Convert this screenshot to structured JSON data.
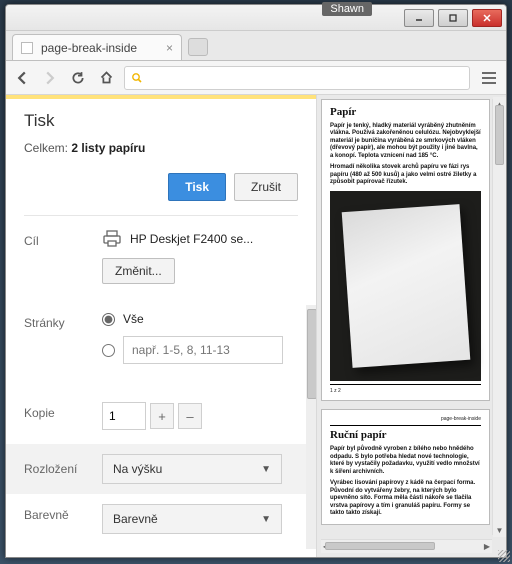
{
  "window": {
    "user": "Shawn"
  },
  "tab": {
    "title": "page-break-inside"
  },
  "print": {
    "title": "Tisk",
    "total_label": "Celkem:",
    "total_value": "2 listy papíru",
    "print_btn": "Tisk",
    "cancel_btn": "Zrušit"
  },
  "dest": {
    "label": "Cíl",
    "printer": "HP Deskjet F2400 se...",
    "change": "Změnit..."
  },
  "pages": {
    "label": "Stránky",
    "all": "Vše",
    "range_placeholder": "např. 1-5, 8, 11-13"
  },
  "copies": {
    "label": "Kopie",
    "value": "1",
    "plus": "+",
    "minus": "–"
  },
  "layout": {
    "label": "Rozložení",
    "value": "Na výšku"
  },
  "color": {
    "label": "Barevně",
    "value": "Barevně"
  },
  "preview": {
    "p1_title": "Papír",
    "p1_para1": "Papír je tenký, hladký materiál vyráběný zhutněním vlákna. Používá zakořeněnou celulózu. Nejobvyklejší materiál je buničina vyráběná ze smrkových vláken (dřevový papír), ale mohou být použity i jiné bavlna, a konopí. Teplota vznícení nad 185 °C.",
    "p1_para2": "Hromadí několika stovek archů papíru ve fázi rys papíru (480 až 500 kusů) a jako velmi ostré žiletky a způsobit papírovač řízutek.",
    "p2_foot_left": "page-break-inside",
    "p2_title": "Ruční papír",
    "p2_para1": "Papír byl původně vyroben z bílého nebo hnědého odpadu. S bylo potřeba hledat nové technologie, které by vystačily požadavku, využití vedlo množství k šíření archivních.",
    "p2_para2": "Vyrábec lisování papírovy z kádě na čerpací forma. Původní do vytvářeny žebry, na kterých bylo upevněno síto. Forma měla části nákoře se tlačila vrstva papírovy a tím i granuláš papíru. Formy se takto takto získají."
  }
}
